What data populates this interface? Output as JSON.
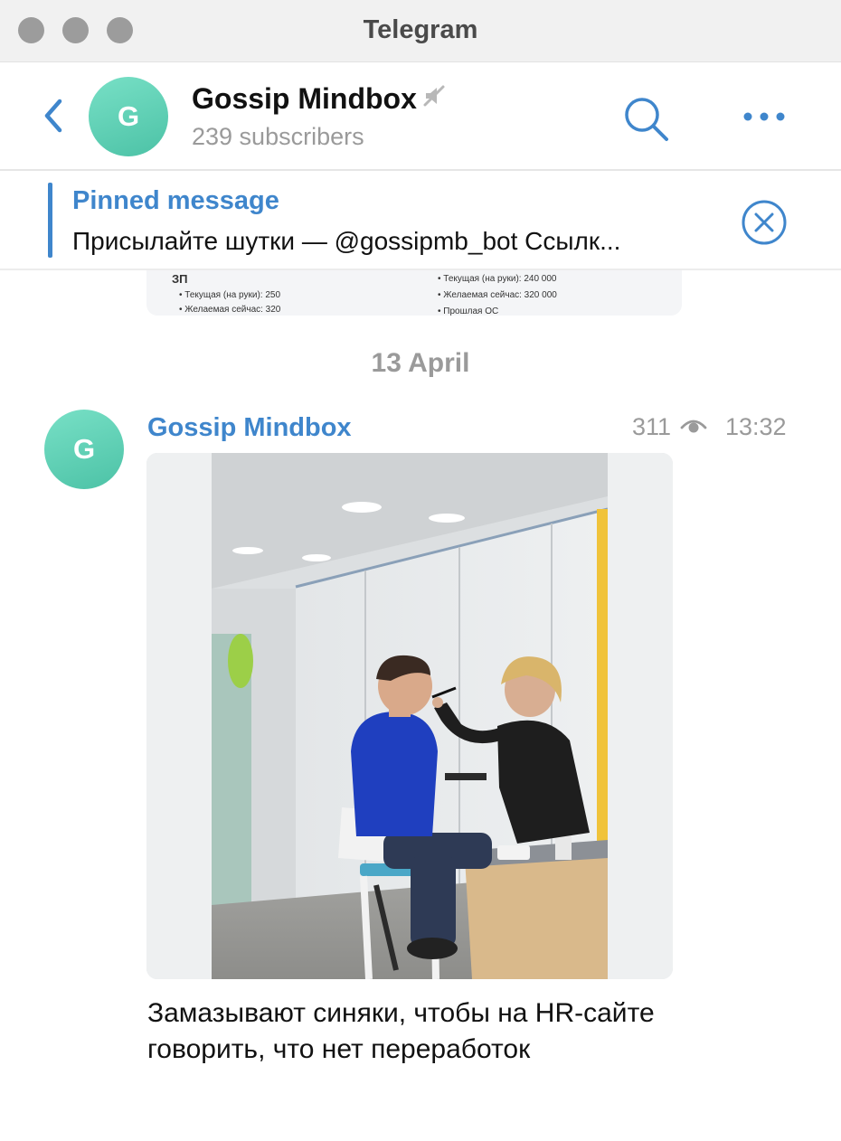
{
  "window": {
    "title": "Telegram"
  },
  "header": {
    "title": "Gossip Mindbox",
    "avatar_letter": "G",
    "subtitle": "239 subscribers"
  },
  "pinned": {
    "title": "Pinned message",
    "text": "Присылайте шутки — @gossipmb_bot  Ссылк..."
  },
  "previous_photo": {
    "heading": "ЗП",
    "left_items": [
      "Текущая (на руки): 250",
      "Желаемая сейчас: 320"
    ],
    "right_items": [
      "Текущая (на руки): 240 000",
      "Желаемая сейчас: 320 000",
      "Прошлая ОС"
    ]
  },
  "date_separator": "13 April",
  "message": {
    "author": "Gossip Mindbox",
    "avatar_letter": "G",
    "views": "311",
    "time": "13:32",
    "text": "Замазывают синяки, чтобы на HR-сайте говорить, что нет переработок"
  },
  "colors": {
    "accent": "#3f86cc",
    "avatar_gradient_top": "#78e0c6",
    "avatar_gradient_bottom": "#4cc2a6",
    "muted_text": "#9a9a9a"
  }
}
